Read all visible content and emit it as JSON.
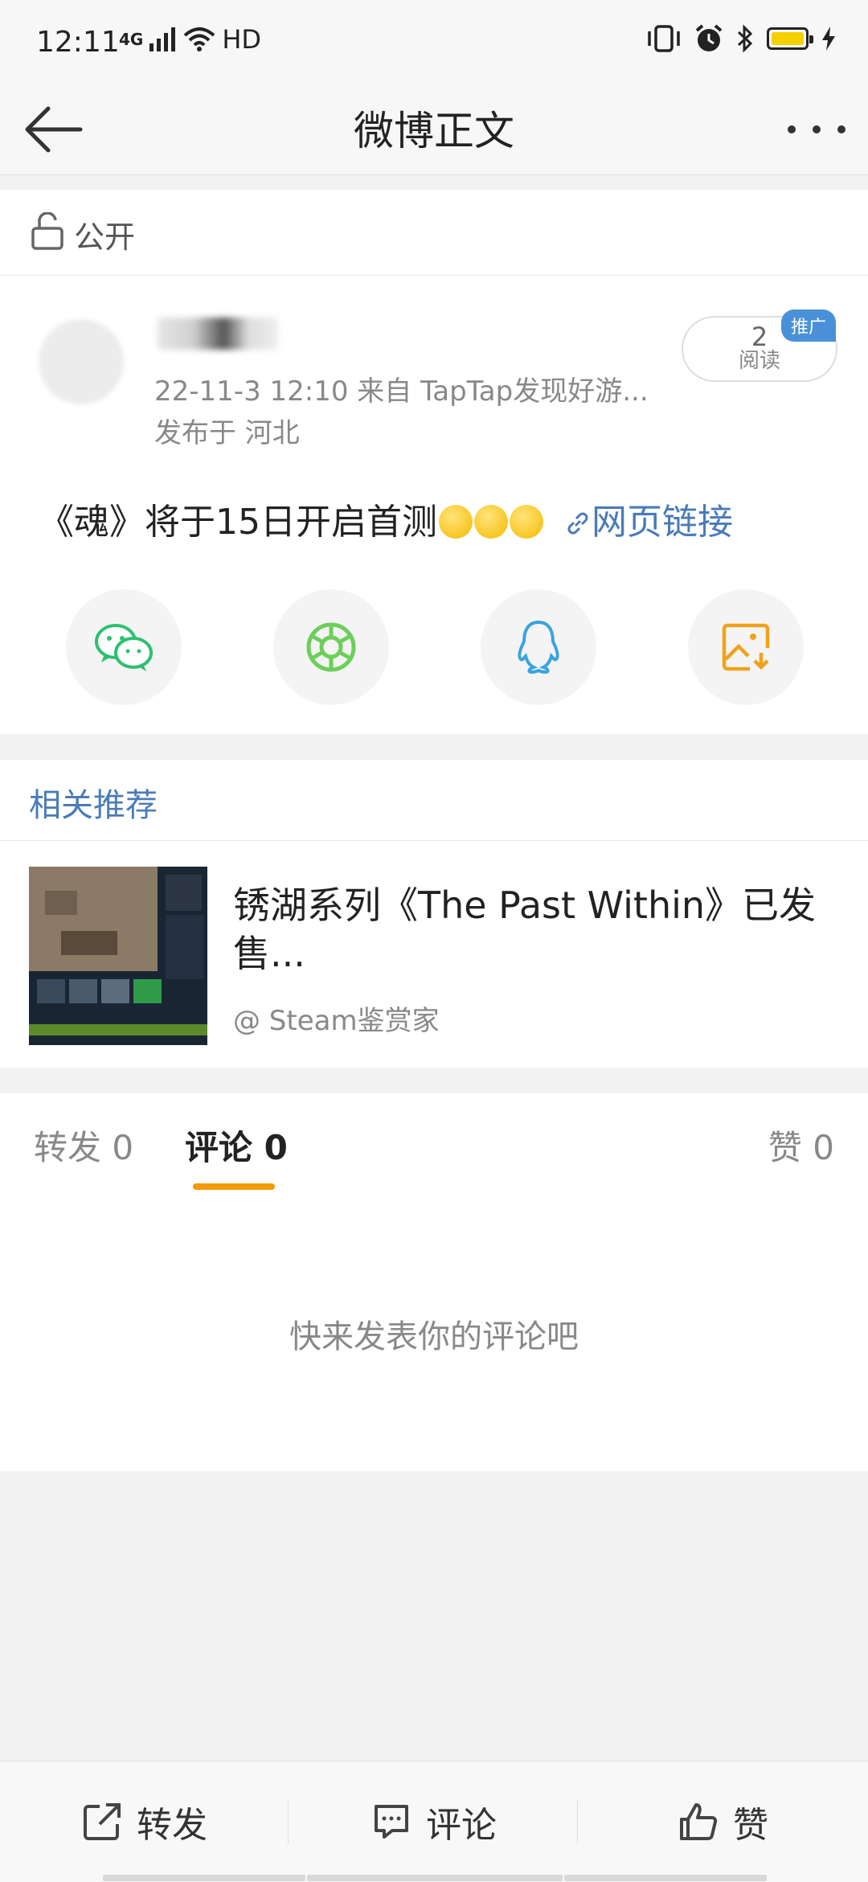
{
  "status_bar": {
    "time": "12:11",
    "network": "4G",
    "hd": "HD"
  },
  "nav": {
    "title": "微博正文"
  },
  "visibility": {
    "label": "公开"
  },
  "post": {
    "meta_time_source": "22-11-3 12:10   来自 TapTap发现好游...",
    "meta_location": "发布于 河北",
    "read_count": "2",
    "read_label": "阅读",
    "promo_tag": "推广",
    "text": "《魂》将于15日开启首测",
    "link_label": "网页链接"
  },
  "share": {
    "icons": [
      "wechat-icon",
      "moments-icon",
      "qq-icon",
      "save-image-icon"
    ]
  },
  "related": {
    "header": "相关推荐",
    "title": "锈湖系列《The Past Within》已发售...",
    "source": "@ Steam鉴赏家"
  },
  "tabs": {
    "repost": "转发 0",
    "comment": "评论 0",
    "like": "赞 0"
  },
  "empty_comment": "快来发表你的评论吧",
  "bottom_bar": {
    "repost": "转发",
    "comment": "评论",
    "like": "赞"
  },
  "colors": {
    "accent_blue": "#4a7bb8",
    "tab_indicator": "#f39a00",
    "wechat_green": "#2fbf71",
    "moments_green": "#6ccf5b",
    "qq_blue": "#3aa3e0",
    "save_orange": "#f0a21a"
  }
}
